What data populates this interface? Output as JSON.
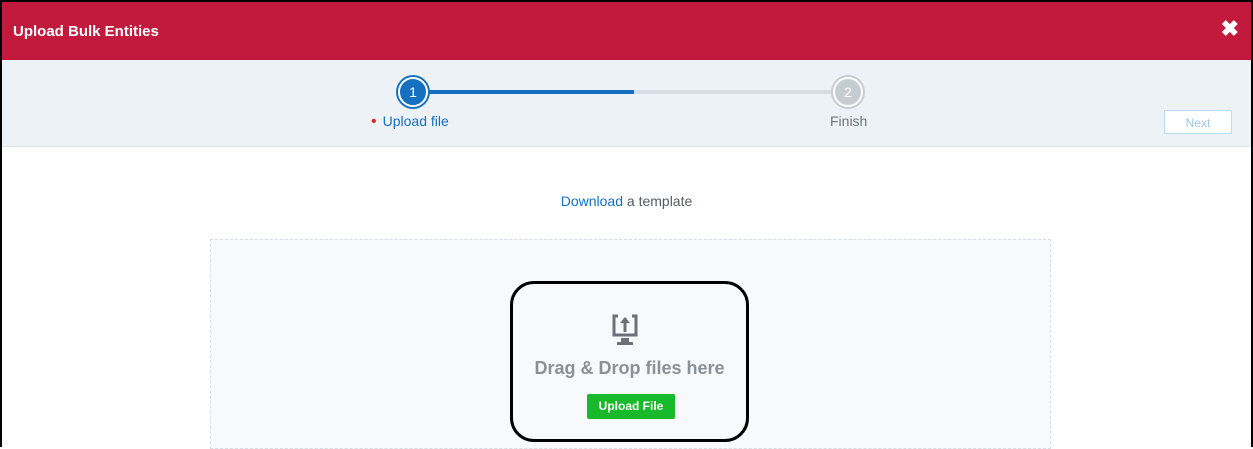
{
  "header": {
    "title": "Upload Bulk Entities",
    "close_label": "✖"
  },
  "stepper": {
    "steps": [
      {
        "number": "1",
        "label": "Upload file"
      },
      {
        "number": "2",
        "label": "Finish"
      }
    ],
    "active_dot": "•",
    "progress": 0.5
  },
  "actions": {
    "next_label": "Next"
  },
  "download": {
    "link_text": "Download",
    "rest_text": " a template"
  },
  "dropzone": {
    "text": "Drag & Drop files here",
    "button_label": "Upload File"
  },
  "colors": {
    "header": "#c11a3d",
    "accent": "#1570c0",
    "upload_button": "#18b92a"
  }
}
